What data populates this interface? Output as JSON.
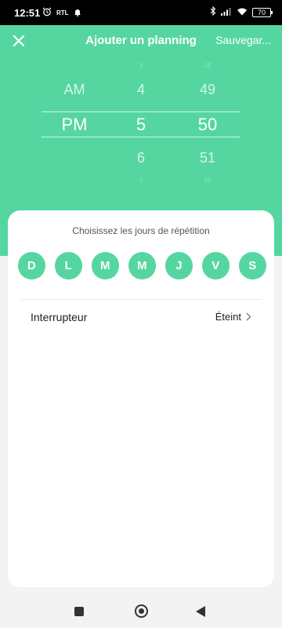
{
  "status_bar": {
    "time": "12:51",
    "left_icons": [
      "alarm-icon",
      "rtl-app-icon",
      "notification-bell-icon"
    ],
    "rtl_label": "RTL",
    "right_icons": [
      "bluetooth-icon",
      "signal-icon",
      "wifi-icon",
      "battery-icon"
    ],
    "battery": "70"
  },
  "header": {
    "title": "Ajouter un planning",
    "save_label": "Sauvegar...",
    "close_icon": "close-icon"
  },
  "time_picker": {
    "period": {
      "options": [
        "AM",
        "PM"
      ],
      "selected": "PM"
    },
    "hour": {
      "above_far": "3",
      "above": "4",
      "selected": "5",
      "below": "6",
      "below_far": "7"
    },
    "minute": {
      "above_far": "48",
      "above": "49",
      "selected": "50",
      "below": "51",
      "below_far": "52"
    }
  },
  "repeat": {
    "label": "Choisissez les jours de répétition",
    "days": [
      "D",
      "L",
      "M",
      "M",
      "J",
      "V",
      "S"
    ]
  },
  "switch_row": {
    "label": "Interrupteur",
    "value": "Éteint",
    "chevron_icon": "chevron-right-icon"
  },
  "colors": {
    "accent": "#55d6a0",
    "background": "#f3f3f3",
    "card": "#ffffff",
    "status_bar": "#000000"
  }
}
